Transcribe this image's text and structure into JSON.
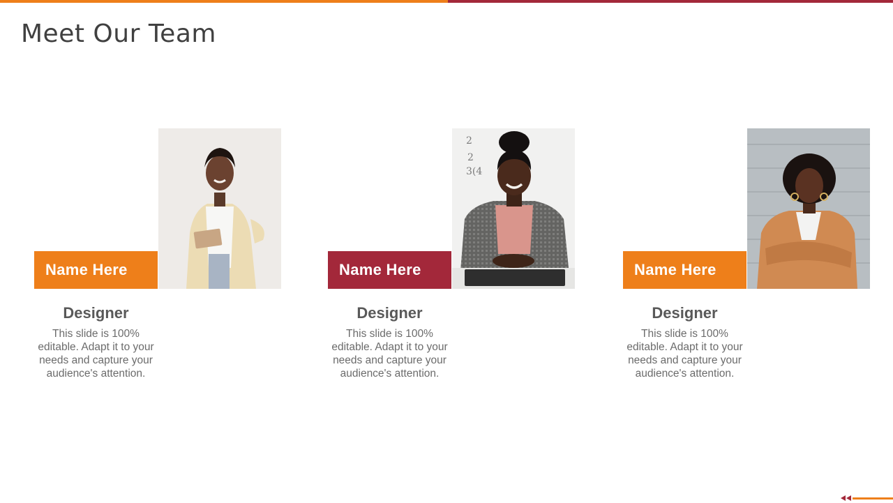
{
  "slide": {
    "title": "Meet Our Team"
  },
  "colors": {
    "accent_orange": "#EE7F1A",
    "accent_maroon": "#A3283A",
    "title_text": "#404040",
    "body_text": "#6b6b6b"
  },
  "members": [
    {
      "name": "Name Here",
      "role": "Designer",
      "description": "This slide is 100% editable. Adapt it to your needs and capture your audience's attention.",
      "tag_color": "#EE7F1A"
    },
    {
      "name": "Name Here",
      "role": "Designer",
      "description": "This slide is 100% editable. Adapt it to your needs and capture your audience's attention.",
      "tag_color": "#A3283A"
    },
    {
      "name": "Name Here",
      "role": "Designer",
      "description": "This slide is 100% editable. Adapt it to your needs and capture your audience's attention.",
      "tag_color": "#EE7F1A"
    }
  ],
  "footer": {
    "icon": "double-arrow-left-icon"
  }
}
